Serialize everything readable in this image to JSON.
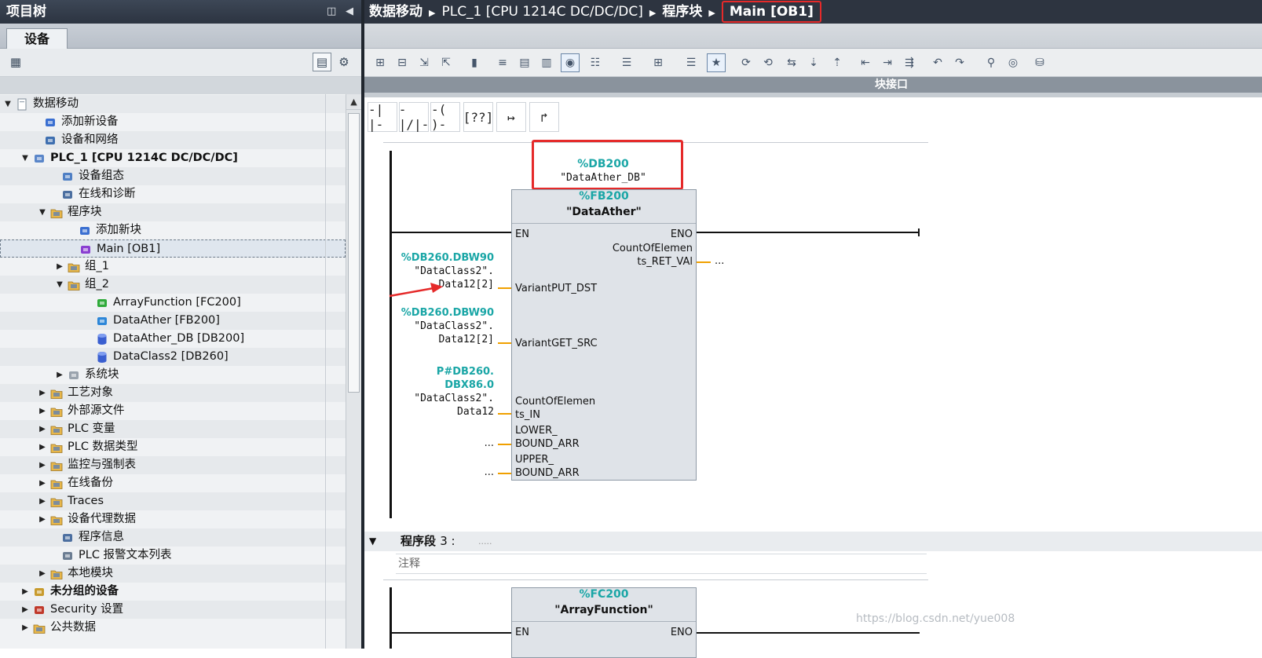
{
  "left_panel": {
    "title": "项目树",
    "tab": "设备",
    "tree": [
      {
        "label": "数据移动",
        "icon": "project-icon"
      },
      {
        "label": "添加新设备",
        "icon": "add-device-icon"
      },
      {
        "label": "设备和网络",
        "icon": "network-icon"
      },
      {
        "label": "PLC_1 [CPU 1214C DC/DC/DC]",
        "icon": "plc-icon"
      },
      {
        "label": "设备组态",
        "icon": "device-config-icon"
      },
      {
        "label": "在线和诊断",
        "icon": "diagnostics-icon"
      },
      {
        "label": "程序块",
        "icon": "folder-icon"
      },
      {
        "label": "添加新块",
        "icon": "add-block-icon"
      },
      {
        "label": "Main [OB1]",
        "icon": "ob-icon"
      },
      {
        "label": "组_1",
        "icon": "group-folder-icon"
      },
      {
        "label": "组_2",
        "icon": "group-folder-icon"
      },
      {
        "label": "ArrayFunction [FC200]",
        "icon": "fc-icon"
      },
      {
        "label": "DataAther [FB200]",
        "icon": "fb-icon"
      },
      {
        "label": "DataAther_DB [DB200]",
        "icon": "db-icon"
      },
      {
        "label": "DataClass2 [DB260]",
        "icon": "db-icon"
      },
      {
        "label": "系统块",
        "icon": "system-block-icon"
      },
      {
        "label": "工艺对象",
        "icon": "folder-icon"
      },
      {
        "label": "外部源文件",
        "icon": "folder-icon"
      },
      {
        "label": "PLC 变量",
        "icon": "folder-icon"
      },
      {
        "label": "PLC 数据类型",
        "icon": "folder-icon"
      },
      {
        "label": "监控与强制表",
        "icon": "folder-icon"
      },
      {
        "label": "在线备份",
        "icon": "folder-icon"
      },
      {
        "label": "Traces",
        "icon": "folder-icon"
      },
      {
        "label": "设备代理数据",
        "icon": "folder-icon"
      },
      {
        "label": "程序信息",
        "icon": "program-info-icon"
      },
      {
        "label": "PLC 报警文本列表",
        "icon": "alarm-text-icon"
      },
      {
        "label": "本地模块",
        "icon": "folder-icon"
      },
      {
        "label": "未分组的设备",
        "icon": "ungrouped-devices-icon"
      },
      {
        "label": "Security 设置",
        "icon": "security-icon"
      },
      {
        "label": "公共数据",
        "icon": "folder-icon"
      }
    ]
  },
  "breadcrumb": [
    "数据移动",
    "PLC_1 [CPU 1214C DC/DC/DC]",
    "程序块",
    "Main [OB1]"
  ],
  "editor": {
    "interface_bar": "块接口",
    "ladder_tools": [
      "-| |-",
      "-|/|-",
      "-( )-",
      "[??]",
      "↦",
      "↱"
    ],
    "network2": {
      "instance_db_addr": "%DB200",
      "instance_db_name": "\"DataAther_DB\"",
      "fb_addr": "%FB200",
      "fb_name": "\"DataAther\"",
      "pin_en": "EN",
      "pin_eno": "ENO",
      "pin_ret_1": "CountOfElemen",
      "pin_ret_2": "ts_RET_VAl",
      "ret_operand": "...",
      "in1_addr": "%DB260.DBW90",
      "in1_name_1": "\"DataClass2\".",
      "in1_name_2": "Data12[2]",
      "in1_pin": "VariantPUT_DST",
      "in2_addr": "%DB260.DBW90",
      "in2_name_1": "\"DataClass2\".",
      "in2_name_2": "Data12[2]",
      "in2_pin": "VariantGET_SRC",
      "in3_addr_1": "P#DB260.",
      "in3_addr_2": "DBX86.0",
      "in3_name_1": "\"DataClass2\".",
      "in3_name_2": "Data12",
      "in3_pin_1": "CountOfElemen",
      "in3_pin_2": "ts_IN",
      "in4_operand": "...",
      "in4_pin_1": "LOWER_",
      "in4_pin_2": "BOUND_ARR",
      "in5_operand": "...",
      "in5_pin_1": "UPPER_",
      "in5_pin_2": "BOUND_ARR"
    },
    "network3": {
      "title": "程序段",
      "number": "3 :",
      "dots": ".....",
      "comment": "注释",
      "fc_addr": "%FC200",
      "fc_name": "\"ArrayFunction\"",
      "pin_en": "EN",
      "pin_eno": "ENO"
    }
  },
  "watermark": "https://blog.csdn.net/yue008",
  "colors": {
    "highlight_red": "#e52a2a",
    "address_teal": "#1aa6a6",
    "operand_wire_orange": "#f0a000",
    "title_bar": "#2d3440"
  }
}
